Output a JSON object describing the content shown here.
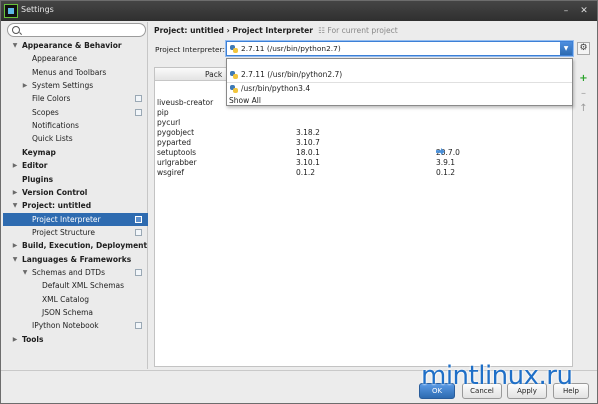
{
  "window": {
    "title": "Settings"
  },
  "sidebar": {
    "search": {
      "value": "",
      "placeholder": ""
    },
    "items": [
      {
        "label": "Appearance & Behavior",
        "bold": true,
        "expanded": true
      },
      {
        "label": "Appearance"
      },
      {
        "label": "Menus and Toolbars"
      },
      {
        "label": "System Settings",
        "expandable": true
      },
      {
        "label": "File Colors",
        "project": true
      },
      {
        "label": "Scopes",
        "project": true
      },
      {
        "label": "Notifications"
      },
      {
        "label": "Quick Lists"
      },
      {
        "label": "Keymap",
        "bold": true
      },
      {
        "label": "Editor",
        "bold": true,
        "expandable": true
      },
      {
        "label": "Plugins",
        "bold": true
      },
      {
        "label": "Version Control",
        "bold": true,
        "expandable": true
      },
      {
        "label": "Project: untitled",
        "bold": true,
        "expanded": true
      },
      {
        "label": "Project Interpreter",
        "selected": true,
        "project": true
      },
      {
        "label": "Project Structure",
        "project": true
      },
      {
        "label": "Build, Execution, Deployment",
        "bold": true,
        "expandable": true
      },
      {
        "label": "Languages & Frameworks",
        "bold": true,
        "expanded": true
      },
      {
        "label": "Schemas and DTDs",
        "expanded": true,
        "project": true
      },
      {
        "label": "Default XML Schemas"
      },
      {
        "label": "XML Catalog"
      },
      {
        "label": "JSON Schema"
      },
      {
        "label": "IPython Notebook",
        "project": true
      },
      {
        "label": "Tools",
        "bold": true,
        "expandable": true
      }
    ]
  },
  "content": {
    "breadcrumb": "Project: untitled › Project Interpreter",
    "breadcrumb_note": "For current project",
    "interpreter_label": "Project Interpreter:",
    "interpreter_value": "2.7.11 (/usr/bin/python2.7)",
    "dropdown_options": [
      "2.7.11 (/usr/bin/python2.7)",
      "/usr/bin/python3.4",
      "Show All"
    ],
    "table": {
      "columns": [
        "Pack"
      ],
      "rows": [
        {
          "package": "liveusb-creator",
          "version": "",
          "latest": ""
        },
        {
          "package": "pip",
          "version": "",
          "latest": ""
        },
        {
          "package": "pycurl",
          "version": "",
          "latest": ""
        },
        {
          "package": "pygobject",
          "version": "3.18.2",
          "latest": ""
        },
        {
          "package": "pyparted",
          "version": "3.10.7",
          "latest": ""
        },
        {
          "package": "setuptools",
          "version": "18.0.1",
          "latest": "20.7.0",
          "upgrade": true
        },
        {
          "package": "urlgrabber",
          "version": "3.10.1",
          "latest": "3.9.1"
        },
        {
          "package": "wsgiref",
          "version": "0.1.2",
          "latest": "0.1.2"
        }
      ]
    }
  },
  "footer": {
    "ok": "OK",
    "cancel": "Cancel",
    "apply": "Apply",
    "help": "Help"
  },
  "watermark": "mintlinux.ru"
}
